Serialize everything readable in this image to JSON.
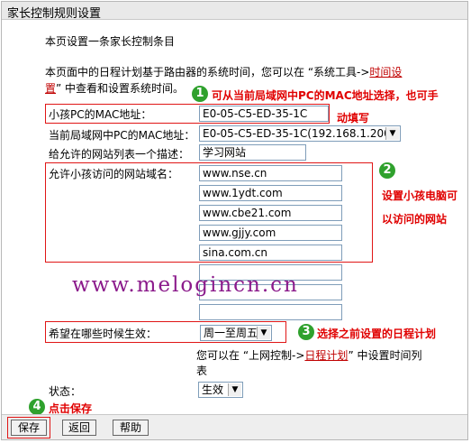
{
  "window": {
    "title": "家长控制规则设置"
  },
  "intro": {
    "line1": "本页设置一条家长控制条目",
    "line2_prefix": "本页面中的日程计划基于路由器的系统时间，您可以在 “系统工具->",
    "line2_link": "时间设",
    "line3_link": "置",
    "line3_suffix": "” 中查看和设置系统时间。"
  },
  "form": {
    "child_mac_label": "小孩PC的MAC地址：",
    "child_mac_value": "E0-05-C5-ED-35-1C",
    "lan_mac_label": "当前局域网中PC的MAC地址：",
    "lan_mac_selected": "E0-05-C5-ED-35-1C(192.168.1.200)",
    "desc_label": "给允许的网站列表一个描述：",
    "desc_value": "学习网站",
    "domains_label": "允许小孩访问的网站域名：",
    "domains": [
      "www.nse.cn",
      "www.1ydt.com",
      "www.cbe21.com",
      "www.gjjy.com",
      "sina.com.cn",
      "",
      "",
      ""
    ],
    "schedule_label": "希望在哪些时候生效：",
    "schedule_selected": "周一至周五",
    "schedule_hint_prefix": "您可以在 “上网控制->",
    "schedule_hint_link": "日程计划",
    "schedule_hint_suffix": "” 中设置时间列",
    "schedule_hint_line2": "表",
    "status_label": "状态：",
    "status_selected": "生效"
  },
  "buttons": {
    "save": "保存",
    "back": "返回",
    "help": "帮助"
  },
  "annotations": {
    "a1_num": "1",
    "a1_text_line1": "可从当前局域网中PC的MAC地址选择，也可手",
    "a1_text_line2": "动填写",
    "a2_num": "2",
    "a2_text_line1": "设置小孩电脑可",
    "a2_text_line2": "以访问的网站",
    "a3_num": "3",
    "a3_text": "选择之前设置的日程计划",
    "a4_num": "4",
    "a4_text": "点击保存"
  },
  "watermark": "www.melogincn.cn",
  "colors": {
    "annotation_red": "#e00000",
    "badge_green": "#2fa12d",
    "link_red": "#c00000"
  }
}
